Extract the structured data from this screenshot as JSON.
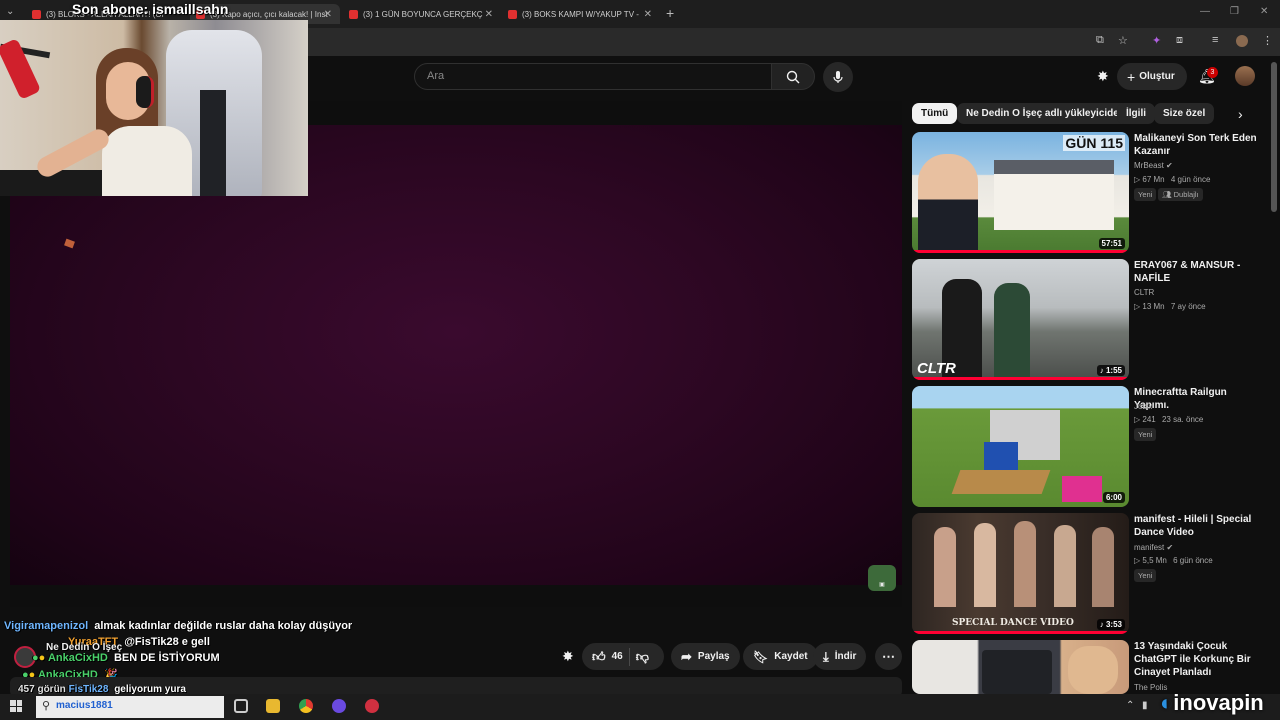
{
  "tabs": [
    {
      "label": "(3) BLOKS - ALLAH ALLAH?! (Of"
    },
    {
      "label": "(3) Kapo açıcı, çıcı kalacak! | Inst"
    },
    {
      "label": "(3) 1 GÜN BOYUNCA GERÇEKÇ"
    },
    {
      "label": "(3) BOKS KAMPI W/YAKUP TV -"
    }
  ],
  "webcam_caption": "Son abone: ismaillsahn",
  "search": {
    "placeholder": "Ara"
  },
  "header": {
    "create_label": "Oluştur",
    "notif_count": "3"
  },
  "chips": [
    "Tümü",
    "Ne Dedin O İşeç adlı yükleyiciden",
    "İlgili",
    "Size özel"
  ],
  "actions": {
    "likes": "46",
    "share": "Paylaş",
    "save": "Kaydet",
    "download": "İndir"
  },
  "chat": [
    {
      "name": "Vigiramapenizol",
      "text": "almak kadınlar değilde ruslar daha kolay düşüyor"
    },
    {
      "name": "YuraaTFT",
      "text": "@FisTik28 e gell"
    },
    {
      "name": "AnkaCixHD",
      "text": "BEN DE İSTİYORUM"
    },
    {
      "name": "AnkaCixHD",
      "text": "🎉"
    },
    {
      "name": "FisTik28",
      "text": "geliyorum yura"
    }
  ],
  "channel_name": "Ne Dedin O İşeç",
  "views_partial": "457 görün",
  "recommendations": [
    {
      "title": "Malikaneyi Son Terk Eden Kazanır",
      "channel": "MrBeast",
      "views": "67 Mn",
      "age": "4 gün önce",
      "badges": [
        "Yeni",
        "Dublajlı"
      ],
      "duration": "57:51",
      "overlay": "GÜN 115",
      "progress": 1.0
    },
    {
      "title": "ERAY067 & MANSUR - NAFİLE",
      "channel": "CLTR",
      "views": "13 Mn",
      "age": "7 ay önce",
      "badges": [],
      "duration": "1:55",
      "overlay": "CLTR",
      "progress": 1.0
    },
    {
      "title": "Minecraftta Railgun Yapımı.",
      "channel": "Jozix",
      "views": "241",
      "age": "23 sa. önce",
      "badges": [
        "Yeni"
      ],
      "duration": "6:00",
      "overlay": "",
      "progress": 0.0
    },
    {
      "title": "manifest - Hileli | Special Dance Video",
      "channel": "manifest",
      "views": "5,5 Mn",
      "age": "6 gün önce",
      "badges": [
        "Yeni"
      ],
      "duration": "3:53",
      "overlay": "SPECIAL DANCE VIDEO",
      "progress": 1.0
    },
    {
      "title": "13 Yaşındaki Çocuk ChatGPT ile Korkunç Bir Cinayet Planladı",
      "channel": "The Polis",
      "views": "",
      "age": "",
      "badges": [],
      "duration": "",
      "overlay": "",
      "progress": 0.0
    }
  ],
  "taskbar": {
    "search_text": "macius1881",
    "watermark": "inovapin"
  },
  "colors": {
    "accent": "#ff0033",
    "background": "#0f0f0f",
    "player": "#2c0722"
  }
}
